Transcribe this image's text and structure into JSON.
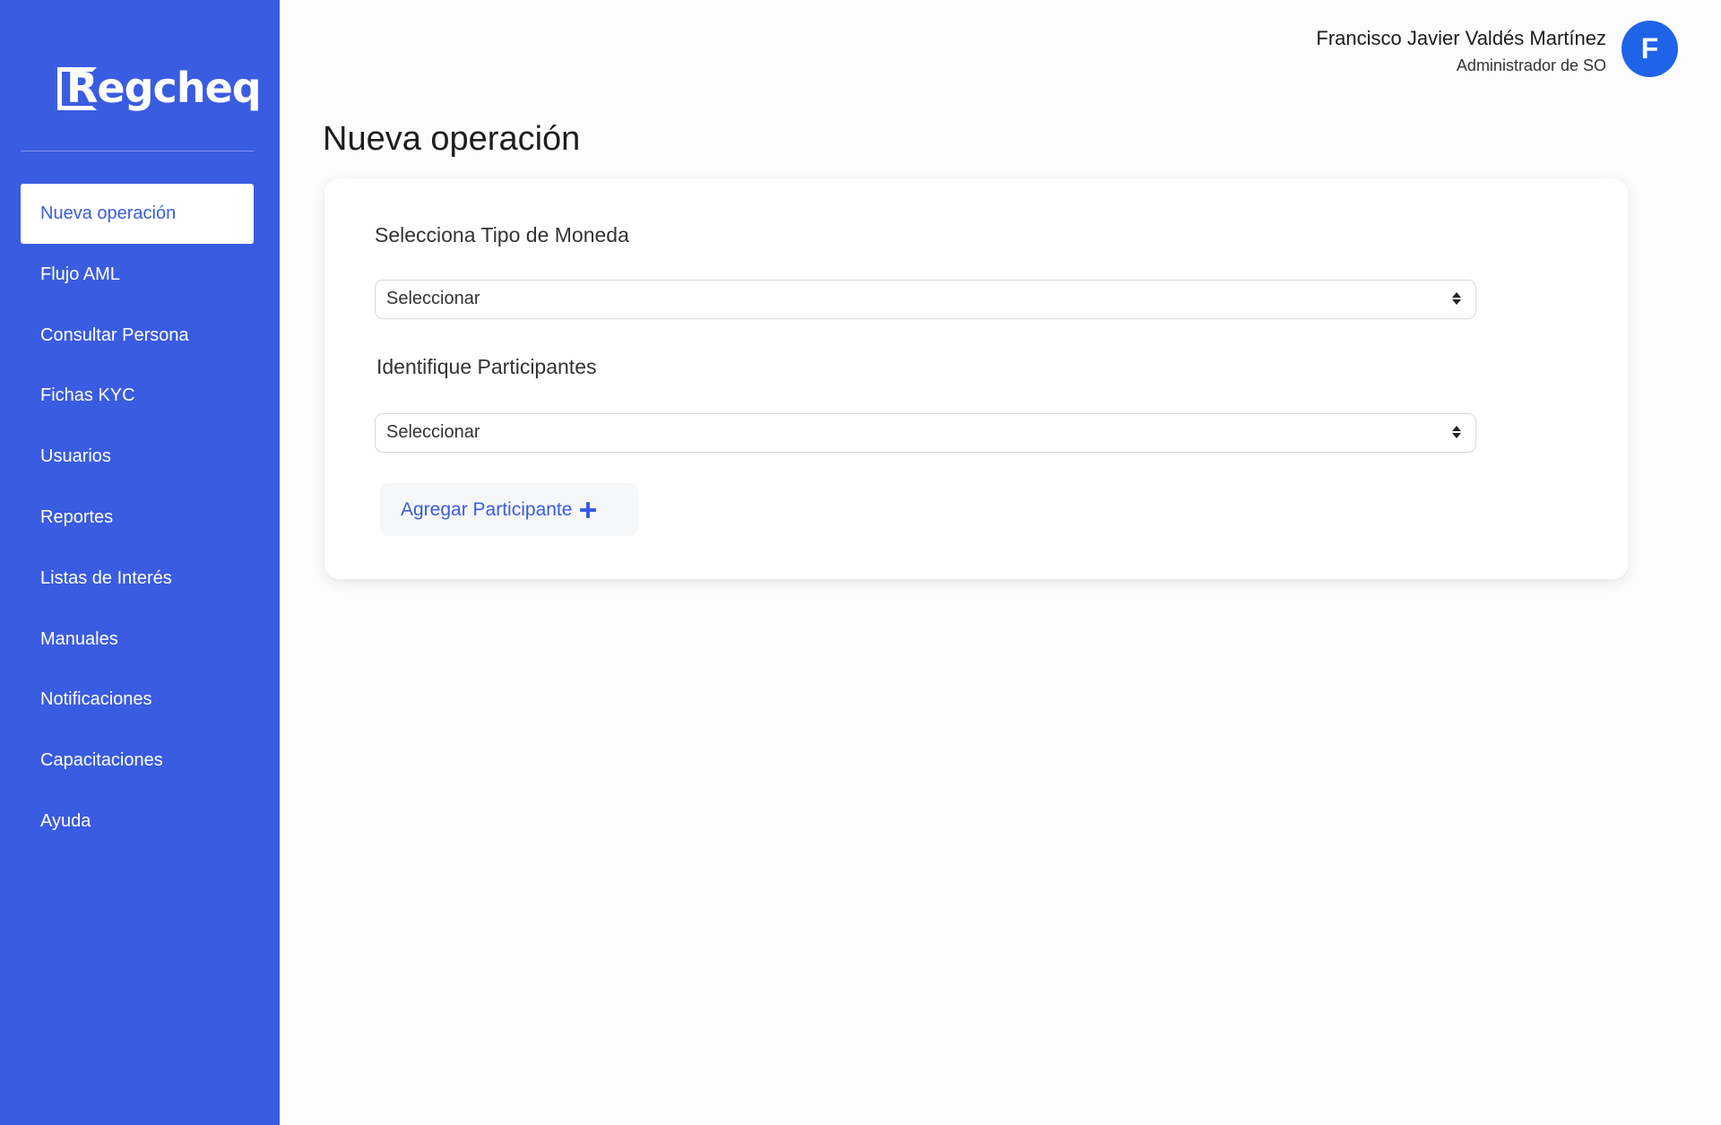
{
  "sidebar": {
    "logo_text": "Regcheq",
    "items": [
      {
        "label": "Nueva operación",
        "active": true
      },
      {
        "label": "Flujo AML"
      },
      {
        "label": "Consultar Persona"
      },
      {
        "label": "Fichas KYC"
      },
      {
        "label": "Usuarios"
      },
      {
        "label": "Reportes"
      },
      {
        "label": "Listas de Interés"
      },
      {
        "label": "Manuales"
      },
      {
        "label": "Notificaciones"
      },
      {
        "label": "Capacitaciones"
      },
      {
        "label": "Ayuda"
      }
    ]
  },
  "header": {
    "user_name": "Francisco Javier Valdés Martínez",
    "user_role": "Administrador de SO",
    "avatar_initial": "F"
  },
  "main": {
    "title": "Nueva operación",
    "currency": {
      "label": "Selecciona Tipo de Moneda",
      "value": "Seleccionar"
    },
    "participants": {
      "label": "Identifique Participantes",
      "value": "Seleccionar"
    },
    "add_participant_label": "Agregar Participante"
  },
  "colors": {
    "sidebar": "#3a5ce0",
    "avatar": "#1f63e8",
    "accent": "#3a5ce0"
  },
  "icons": {
    "select_arrows": "updown-chevron-icon",
    "add": "plus-icon"
  }
}
